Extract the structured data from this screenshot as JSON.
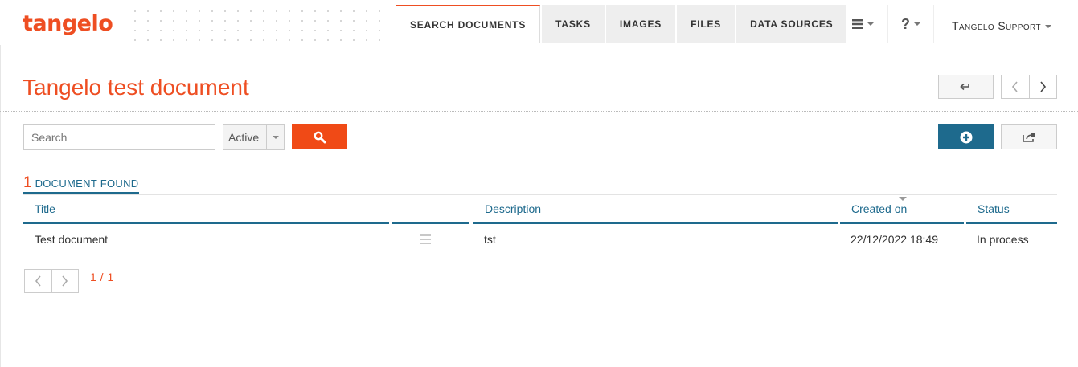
{
  "brand": {
    "logo_text": "tangelo",
    "accent": "#ee4e22",
    "primary": "#1e6a8d"
  },
  "nav": {
    "tabs": [
      {
        "label": "Search Documents",
        "active": true
      },
      {
        "label": "Tasks",
        "active": false
      },
      {
        "label": "Images",
        "active": false
      },
      {
        "label": "Files",
        "active": false
      },
      {
        "label": "Data Sources",
        "active": false
      }
    ],
    "menu_icon": "hamburger-icon",
    "help_label": "?",
    "user_label": "Tangelo Support"
  },
  "page": {
    "title": "Tangelo test document"
  },
  "toolbar": {
    "back_icon": "return-arrow-icon",
    "prev_icon": "chevron-left-icon",
    "next_icon": "chevron-right-icon",
    "add_icon": "plus-circle-icon",
    "export_icon": "export-icon"
  },
  "search": {
    "placeholder": "Search",
    "value": "",
    "status_selected": "Active",
    "button_icon": "search-icon"
  },
  "results": {
    "count": "1",
    "label": "Document found",
    "columns": [
      "Title",
      "Description",
      "Created on",
      "Status"
    ],
    "sorted_column": "Created on",
    "rows": [
      {
        "title": "Test document",
        "description": "tst",
        "created_on": "22/12/2022 18:49",
        "status": "In process"
      }
    ]
  },
  "pagination": {
    "page_info": "1 / 1"
  }
}
